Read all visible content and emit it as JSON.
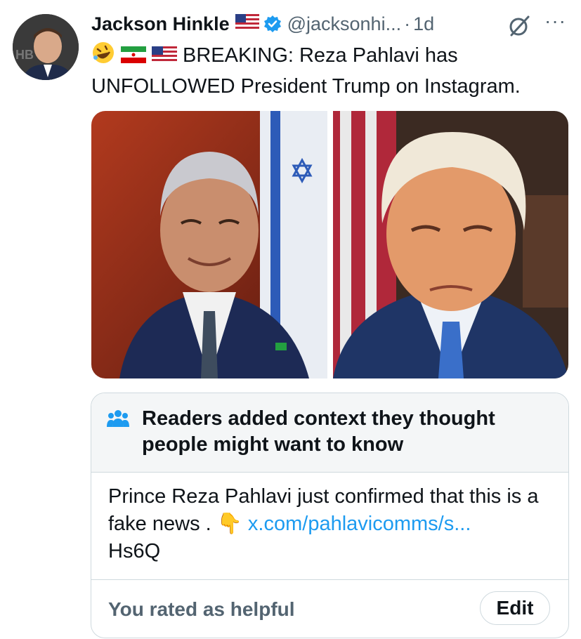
{
  "tweet": {
    "author_name": "Jackson Hinkle",
    "handle": "@jacksonhi...",
    "separator": "·",
    "time": "1d",
    "more_label": "···",
    "text": "BREAKING: Reza Pahlavi has UNFOLLOWED President Trump on Instagram.",
    "emojis": [
      "rofl-emoji",
      "iran-flag",
      "us-flag"
    ],
    "verified_color": "#1d9bf0"
  },
  "community_note": {
    "title": "Readers added context they thought people might want to know",
    "body_text": "Prince Reza Pahlavi just confirmed that this is a fake news . ",
    "pointer_emoji": "👇",
    "link_text": "x.com/pahlavicomms/s...",
    "body_tail": "Hs6Q",
    "rated_label": "You rated as helpful",
    "edit_label": "Edit",
    "icon_color": "#1d9bf0"
  }
}
